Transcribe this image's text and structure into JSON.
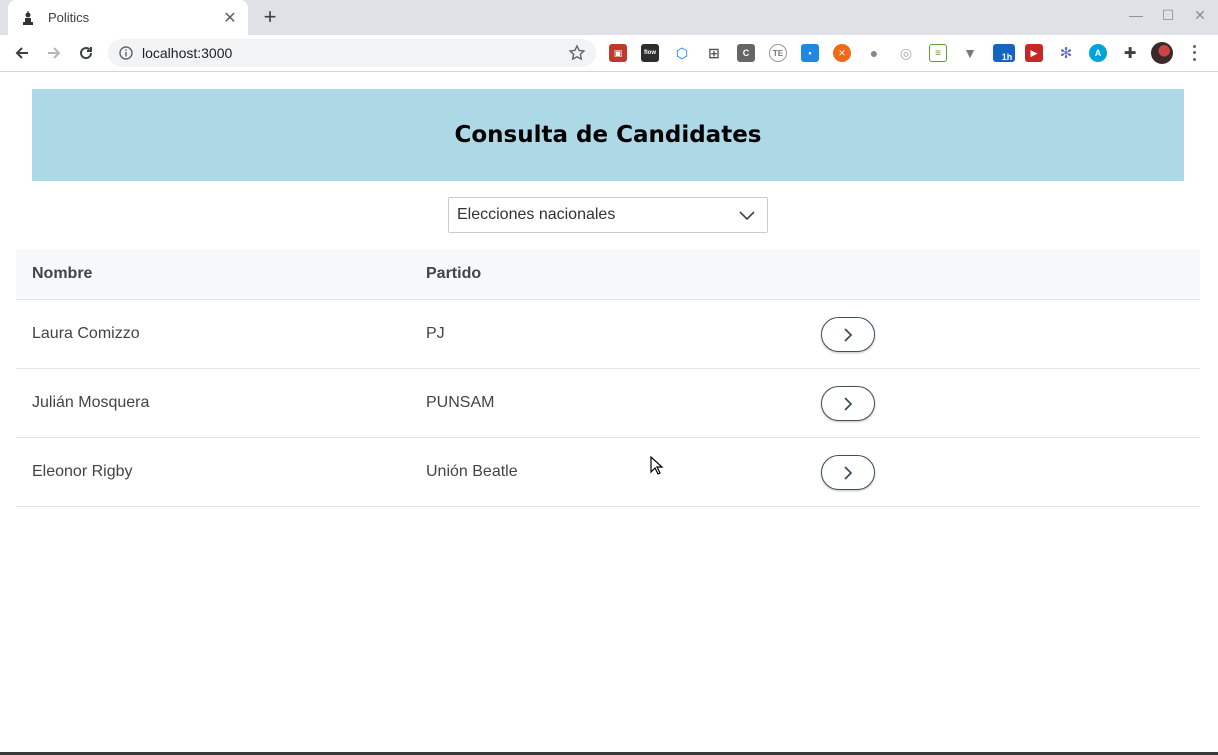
{
  "browser": {
    "tab_title": "Politics",
    "url": "localhost:3000",
    "extensions": [
      "ext-red-icon",
      "flow-icon",
      "cube-icon",
      "grid-icon",
      "c-icon",
      "te-icon",
      "blue-square-icon",
      "orange-circle-icon",
      "gray-dot-icon",
      "target-icon",
      "sheet-icon",
      "v-icon",
      "badge-1h-icon",
      "red-play-icon",
      "snowflake-icon",
      "a-circle-icon",
      "puzzle-icon"
    ],
    "badge_label": "1h"
  },
  "header": {
    "title": "Consulta de Candidates"
  },
  "filter": {
    "selected": "Elecciones nacionales"
  },
  "table": {
    "columns": [
      "Nombre",
      "Partido"
    ],
    "rows": [
      {
        "nombre": "Laura Comizzo",
        "partido": "PJ"
      },
      {
        "nombre": "Julián Mosquera",
        "partido": "PUNSAM"
      },
      {
        "nombre": "Eleonor Rigby",
        "partido": "Unión Beatle"
      }
    ]
  },
  "colors": {
    "banner": "#add8e6",
    "button_border": "#3c4f5e"
  }
}
